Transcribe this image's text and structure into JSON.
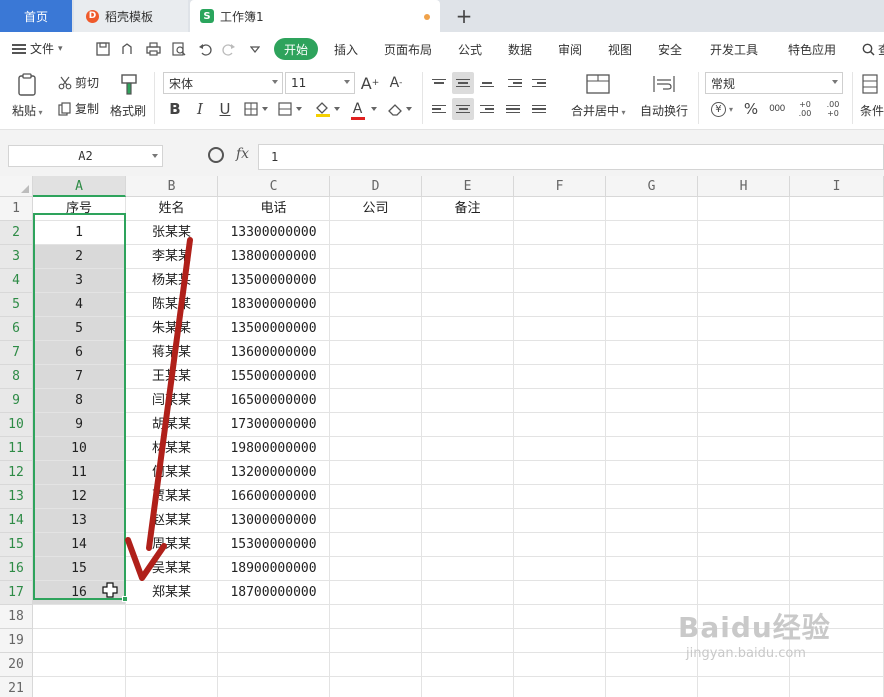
{
  "tabs": {
    "home": "首页",
    "template": "稻壳模板",
    "workbook": "工作簿1",
    "add": "+"
  },
  "menu": {
    "file": "文件",
    "items": [
      "开始",
      "插入",
      "页面布局",
      "公式",
      "数据",
      "审阅",
      "视图",
      "安全",
      "开发工具",
      "特色应用"
    ],
    "search_fragment": "查"
  },
  "ribbon": {
    "paste": "粘贴",
    "cut": "剪切",
    "copy": "复制",
    "format_painter": "格式刷",
    "font_name": "宋体",
    "font_size": "11",
    "bold": "B",
    "italic": "I",
    "underline": "U",
    "font_color_letter": "A",
    "merge_center": "合并居中",
    "wrap_text": "自动换行",
    "number_format": "常规",
    "currency": "¥",
    "percent": "%",
    "thousands": "000",
    "inc_decimal": "+0 .00",
    "dec_decimal": ".00 +0",
    "conditional_fragment": "条件"
  },
  "formula": {
    "cell_ref": "A2",
    "fx": "fx",
    "value": "1"
  },
  "grid": {
    "columns": [
      "A",
      "B",
      "C",
      "D",
      "E",
      "F",
      "G",
      "H",
      "I"
    ],
    "rows": [
      "1",
      "2",
      "3",
      "4",
      "5",
      "6",
      "7",
      "8",
      "9",
      "10",
      "11",
      "12",
      "13",
      "14",
      "15",
      "16",
      "17",
      "18",
      "19",
      "20",
      "21"
    ],
    "header_row": [
      "序号",
      "姓名",
      "电话",
      "公司",
      "备注"
    ],
    "data": [
      [
        "1",
        "张某某",
        "13300000000"
      ],
      [
        "2",
        "李某某",
        "13800000000"
      ],
      [
        "3",
        "杨某某",
        "13500000000"
      ],
      [
        "4",
        "陈某某",
        "18300000000"
      ],
      [
        "5",
        "朱某某",
        "13500000000"
      ],
      [
        "6",
        "蒋某某",
        "13600000000"
      ],
      [
        "7",
        "王某某",
        "15500000000"
      ],
      [
        "8",
        "闫某某",
        "16500000000"
      ],
      [
        "9",
        "胡某某",
        "17300000000"
      ],
      [
        "10",
        "林某某",
        "19800000000"
      ],
      [
        "11",
        "何某某",
        "13200000000"
      ],
      [
        "12",
        "贾某某",
        "16600000000"
      ],
      [
        "13",
        "赵某某",
        "13000000000"
      ],
      [
        "14",
        "周某某",
        "15300000000"
      ],
      [
        "15",
        "吴某某",
        "18900000000"
      ],
      [
        "16",
        "郑某某",
        "18700000000"
      ]
    ],
    "selection": "A2:A17"
  },
  "watermark": {
    "main": "Baidu经验",
    "sub": "jingyan.baidu.com"
  },
  "colors": {
    "accent_green": "#2ea35c",
    "tab_blue": "#3a78d6",
    "arrow_red": "#b0201a"
  }
}
